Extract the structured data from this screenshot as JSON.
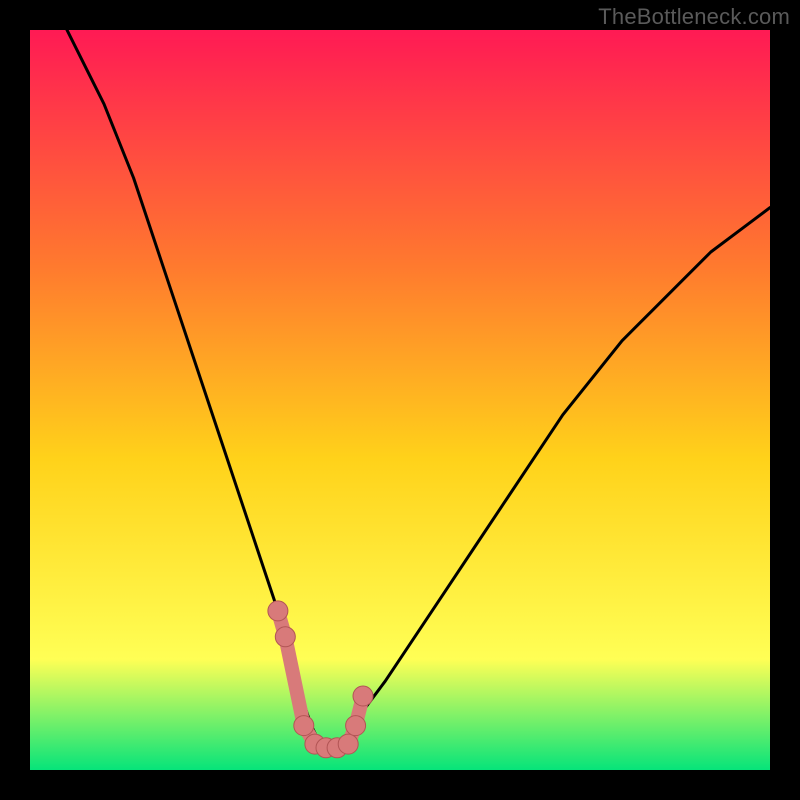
{
  "watermark": "TheBottleneck.com",
  "colors": {
    "background": "#000000",
    "gradient_top": "#ff1a54",
    "gradient_mid_upper": "#ff7a2e",
    "gradient_mid": "#ffd21a",
    "gradient_lower": "#ffff55",
    "gradient_bottom": "#06e47a",
    "curve": "#000000",
    "marker_fill": "#d87a7a",
    "marker_stroke": "#b25555"
  },
  "chart_data": {
    "type": "line",
    "title": "",
    "xlabel": "",
    "ylabel": "",
    "xlim": [
      0,
      100
    ],
    "ylim": [
      0,
      100
    ],
    "series": [
      {
        "name": "bottleneck-curve",
        "x": [
          5,
          8,
          10,
          12,
          14,
          16,
          18,
          20,
          22,
          24,
          26,
          28,
          30,
          32,
          34,
          35,
          36,
          37,
          38,
          39,
          40,
          41,
          42,
          43,
          45,
          48,
          52,
          56,
          60,
          64,
          68,
          72,
          76,
          80,
          84,
          88,
          92,
          96,
          100
        ],
        "y": [
          100,
          94,
          90,
          85,
          80,
          74,
          68,
          62,
          56,
          50,
          44,
          38,
          32,
          26,
          20,
          16,
          12,
          9,
          6,
          4,
          3,
          3,
          4,
          5,
          8,
          12,
          18,
          24,
          30,
          36,
          42,
          48,
          53,
          58,
          62,
          66,
          70,
          73,
          76
        ]
      }
    ],
    "markers": {
      "name": "highlighted-points",
      "x": [
        33.5,
        34.5,
        37.0,
        38.5,
        40.0,
        41.5,
        43.0,
        44.0,
        45.0
      ],
      "y": [
        21.5,
        18.0,
        6.0,
        3.5,
        3.0,
        3.0,
        3.5,
        6.0,
        10.0
      ]
    }
  }
}
